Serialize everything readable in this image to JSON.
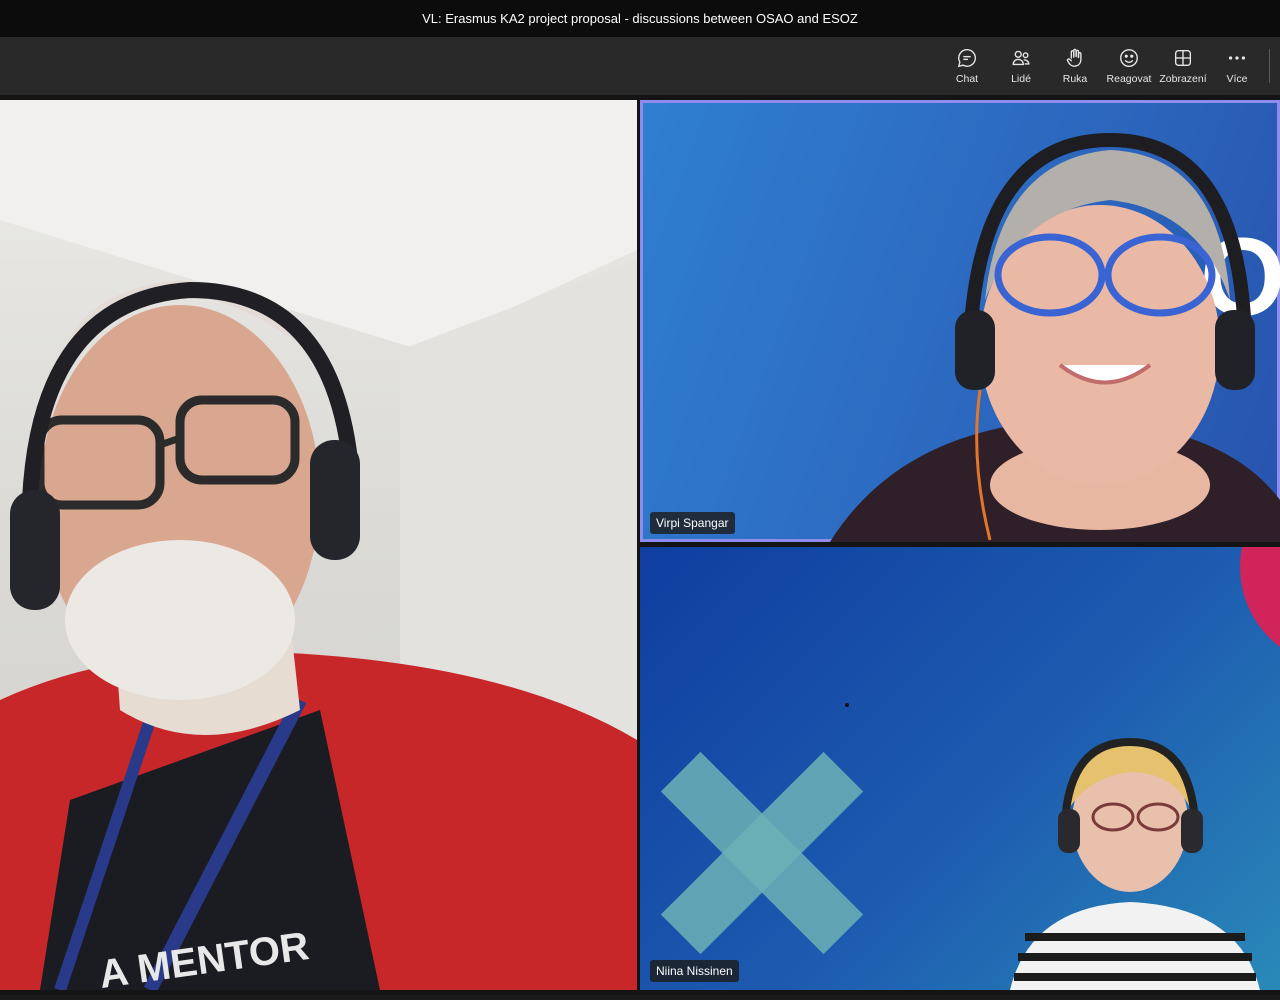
{
  "window": {
    "title": "VL: Erasmus KA2 project proposal - discussions between OSAO and ESOZ"
  },
  "toolbar": {
    "buttons": [
      {
        "label": "Chat",
        "icon": "chat-icon"
      },
      {
        "label": "Lidé",
        "icon": "people-icon"
      },
      {
        "label": "Ruka",
        "icon": "raise-hand-icon"
      },
      {
        "label": "Reagovat",
        "icon": "emoji-icon"
      },
      {
        "label": "Zobrazení",
        "icon": "view-grid-icon"
      },
      {
        "label": "Více",
        "icon": "more-icon"
      }
    ]
  },
  "participants": [
    {
      "name": ""
    },
    {
      "name": "Virpi Spangar"
    },
    {
      "name": "Niina Nissinen"
    }
  ],
  "colors": {
    "active_speaker_border": "#8f8cf0",
    "toolbar_bg": "#292929",
    "titlebar_bg": "#0c0c0c"
  }
}
